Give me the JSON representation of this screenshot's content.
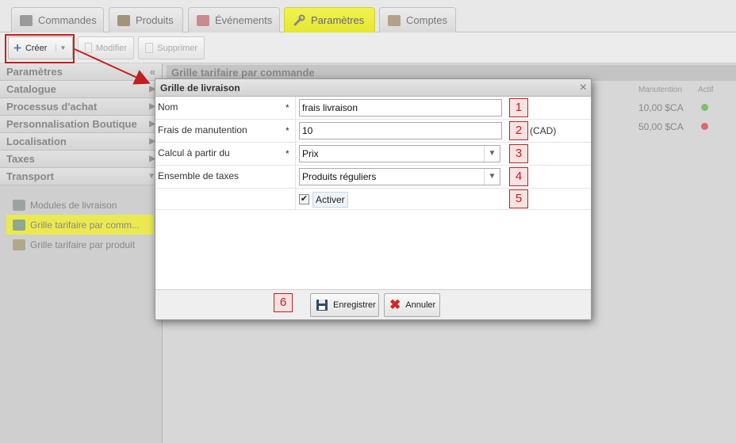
{
  "tabs": [
    {
      "label": "Commandes",
      "icon": "orders-icon"
    },
    {
      "label": "Produits",
      "icon": "products-icon"
    },
    {
      "label": "Événements",
      "icon": "events-icon"
    },
    {
      "label": "Paramètres",
      "icon": "settings-wrench-icon"
    },
    {
      "label": "Comptes",
      "icon": "accounts-icon"
    }
  ],
  "toolbar": {
    "create": "Créer",
    "modify": "Modifier",
    "delete": "Supprimer"
  },
  "sidebar": {
    "header": "Paramètres",
    "sections": [
      "Catalogue",
      "Processus d'achat",
      "Personnalisation Boutique",
      "Localisation",
      "Taxes",
      "Transport"
    ],
    "items": [
      "Modules de livraison",
      "Grille tarifaire par comm...",
      "Grille tarifaire par produit"
    ]
  },
  "main": {
    "title": "Grille tarifaire par commande",
    "columns": [
      "Manutention",
      "Actif"
    ],
    "rows": [
      {
        "handling": "10,00 $CA",
        "active": true
      },
      {
        "handling": "50,00 $CA",
        "active": false
      }
    ]
  },
  "dialog": {
    "title": "Grille de livraison",
    "fields": [
      {
        "label": "Nom",
        "required": "*",
        "value": "frais livraison"
      },
      {
        "label": "Frais de manutention",
        "required": "*",
        "value": "10",
        "suffix": "(CAD)"
      },
      {
        "label": "Calcul à partir du",
        "required": "*",
        "value": "Prix"
      },
      {
        "label": "Ensemble de taxes",
        "value": "Produits réguliers"
      }
    ],
    "activate_label": "Activer",
    "save": "Enregistrer",
    "cancel": "Annuler"
  },
  "callouts": [
    "1",
    "2",
    "3",
    "4",
    "5",
    "6"
  ],
  "colors": {
    "highlight": "#e6e633",
    "callout": "#c02020",
    "active_green": "#5cb85c",
    "inactive_red": "#d9534f"
  }
}
